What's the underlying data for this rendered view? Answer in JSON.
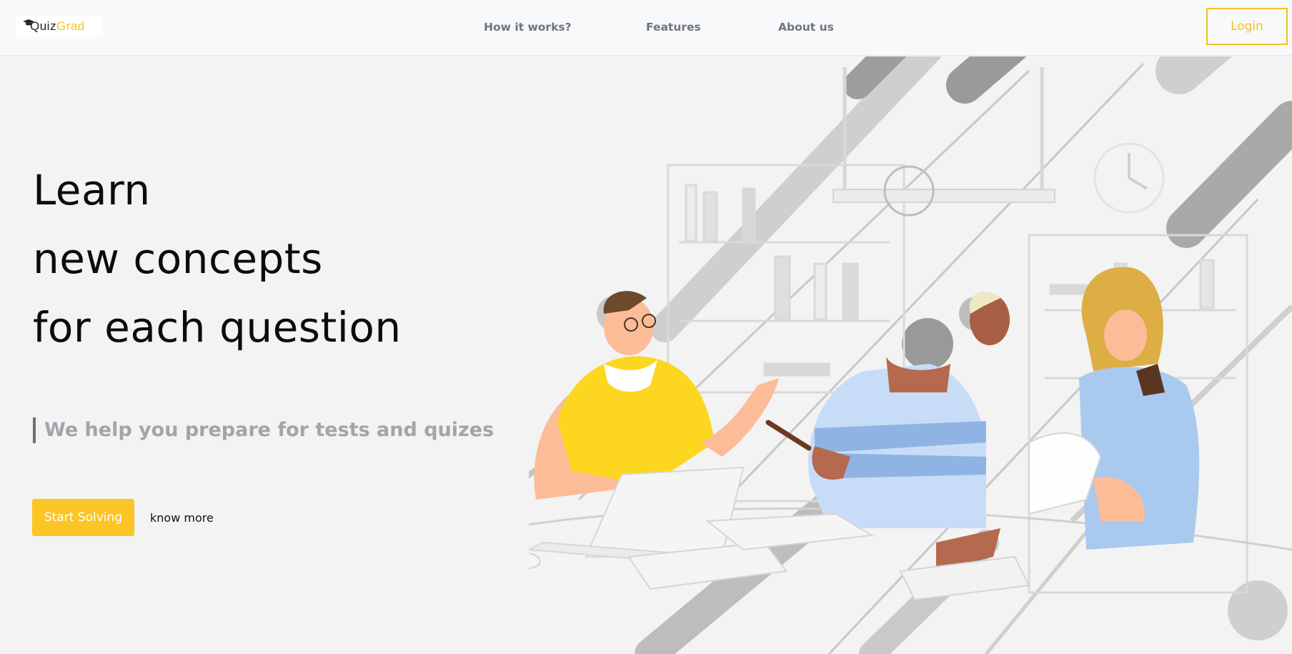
{
  "navbar": {
    "logo": {
      "part1": "Quiz",
      "part2": "Grad"
    },
    "links": [
      {
        "label": "How it works?"
      },
      {
        "label": "Features"
      },
      {
        "label": "About us"
      }
    ],
    "login_label": "Login"
  },
  "hero": {
    "lines": [
      "Learn",
      "new concepts",
      "for each question"
    ],
    "tagline": "We help you prepare for tests and quizes",
    "cta_label": "Start Solving",
    "secondary_label": "know more"
  },
  "colors": {
    "accent": "#fbc526",
    "nav_text": "#70757d",
    "tagline": "#a0a5ac",
    "background": "#f2f3f2"
  },
  "icons": [
    "graduation-cap-icon"
  ]
}
